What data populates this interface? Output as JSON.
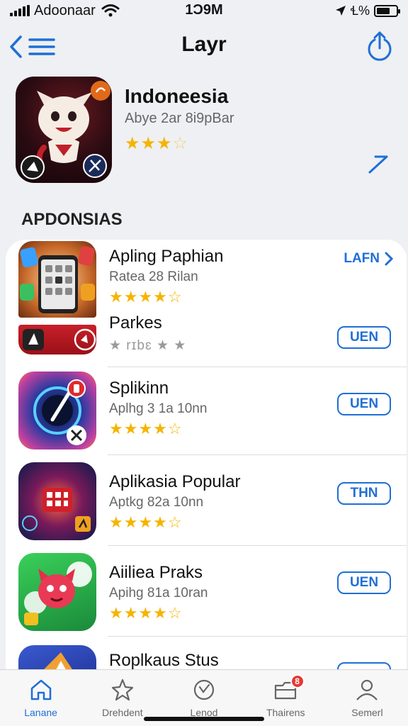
{
  "status": {
    "carrier": "Adoonaar",
    "time": "1Ɔ9M",
    "right_text": "Ɬ%"
  },
  "nav": {
    "title": "Layr"
  },
  "featured": {
    "name": "Indoneesia",
    "subtitle": "Abye 2ar 8i9pBar",
    "rating": 3.5
  },
  "section": {
    "title": "APDONSIAS"
  },
  "apps": [
    {
      "name": "Apling Paphian",
      "subtitle": "Ratea 28 Rilan",
      "rating_text": "★★★★☆",
      "action": "LAFN",
      "action_style": "link"
    },
    {
      "name": "Parkes",
      "subtitle": "",
      "rating_text": "★ rɪbɛ ★ ★",
      "action": "UEN",
      "action_style": "button"
    },
    {
      "name": "Splikinn",
      "subtitle": "Aplhg 3 1a 10nn",
      "rating_text": "★★★★☆",
      "action": "UEN",
      "action_style": "button"
    },
    {
      "name": "Aplikasia Popular",
      "subtitle": "Aptkg 82a 10nn",
      "rating_text": "★★★★☆",
      "action": "THN",
      "action_style": "button"
    },
    {
      "name": "Aiiliea Praks",
      "subtitle": "Apihg 81a 10ran",
      "rating_text": "★★★★☆",
      "action": "UEN",
      "action_style": "button"
    },
    {
      "name": "Roplkaus Stus",
      "subtitle": "",
      "rating_text": "",
      "action": "",
      "action_style": "button"
    }
  ],
  "tabs": [
    {
      "label": "Lanane",
      "icon": "home-icon",
      "active": true
    },
    {
      "label": "Drehdent",
      "icon": "star-icon",
      "active": false
    },
    {
      "label": "Lenod",
      "icon": "search-icon",
      "active": false
    },
    {
      "label": "Thairens",
      "icon": "tray-icon",
      "active": false,
      "badge": "8"
    },
    {
      "label": "Semerl",
      "icon": "person-icon",
      "active": false
    }
  ],
  "colors": {
    "accent": "#1f6fd6",
    "star": "#f5b400",
    "badge": "#e53935"
  }
}
